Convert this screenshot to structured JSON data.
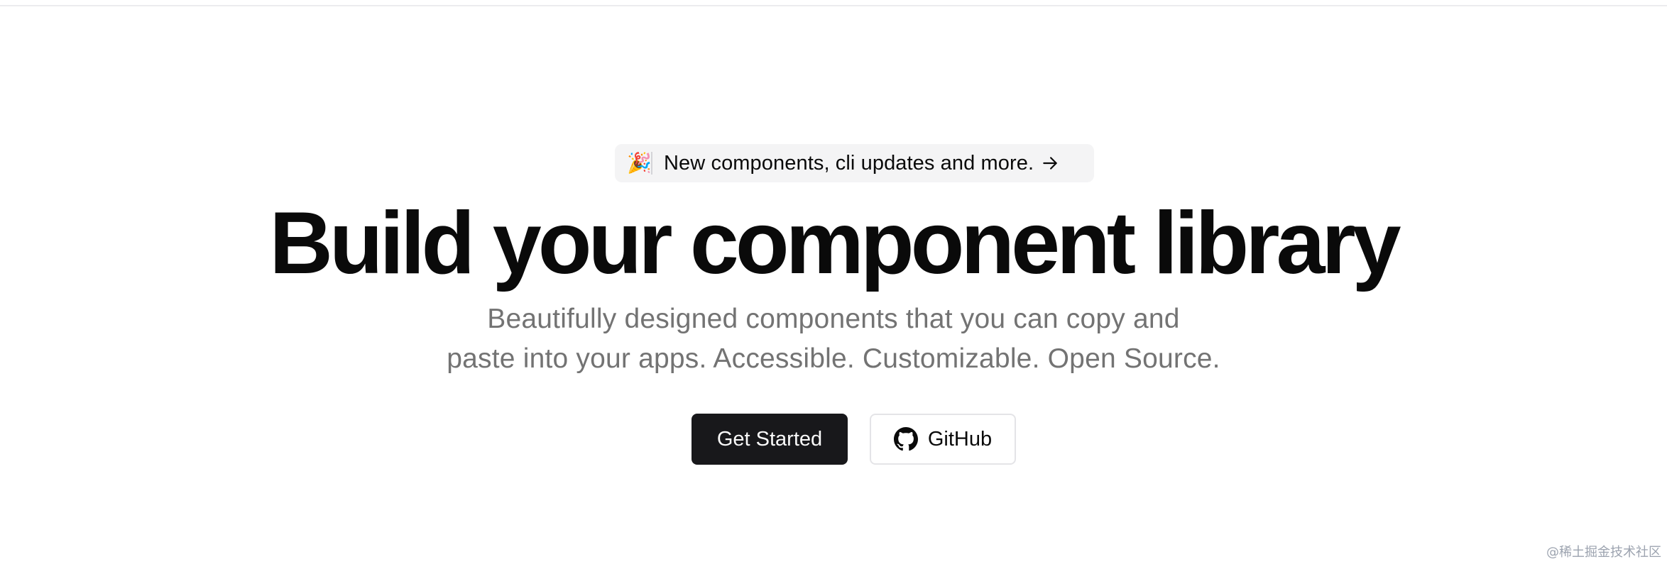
{
  "announcement": {
    "emoji": "🎉",
    "text": "New components, cli updates and more.",
    "icon": "arrow-right-icon"
  },
  "hero": {
    "title": "Build your component library",
    "subtitle_line1": "Beautifully designed components that you can copy and",
    "subtitle_line2": "paste into your apps. Accessible. Customizable. Open Source."
  },
  "actions": {
    "primary_label": "Get Started",
    "secondary_label": "GitHub",
    "secondary_icon": "github-icon"
  },
  "watermark": {
    "text": "@稀土掘金技术社区"
  },
  "colors": {
    "primary_bg": "#18181b",
    "muted_text": "#737373",
    "pill_bg": "#f4f4f5"
  }
}
